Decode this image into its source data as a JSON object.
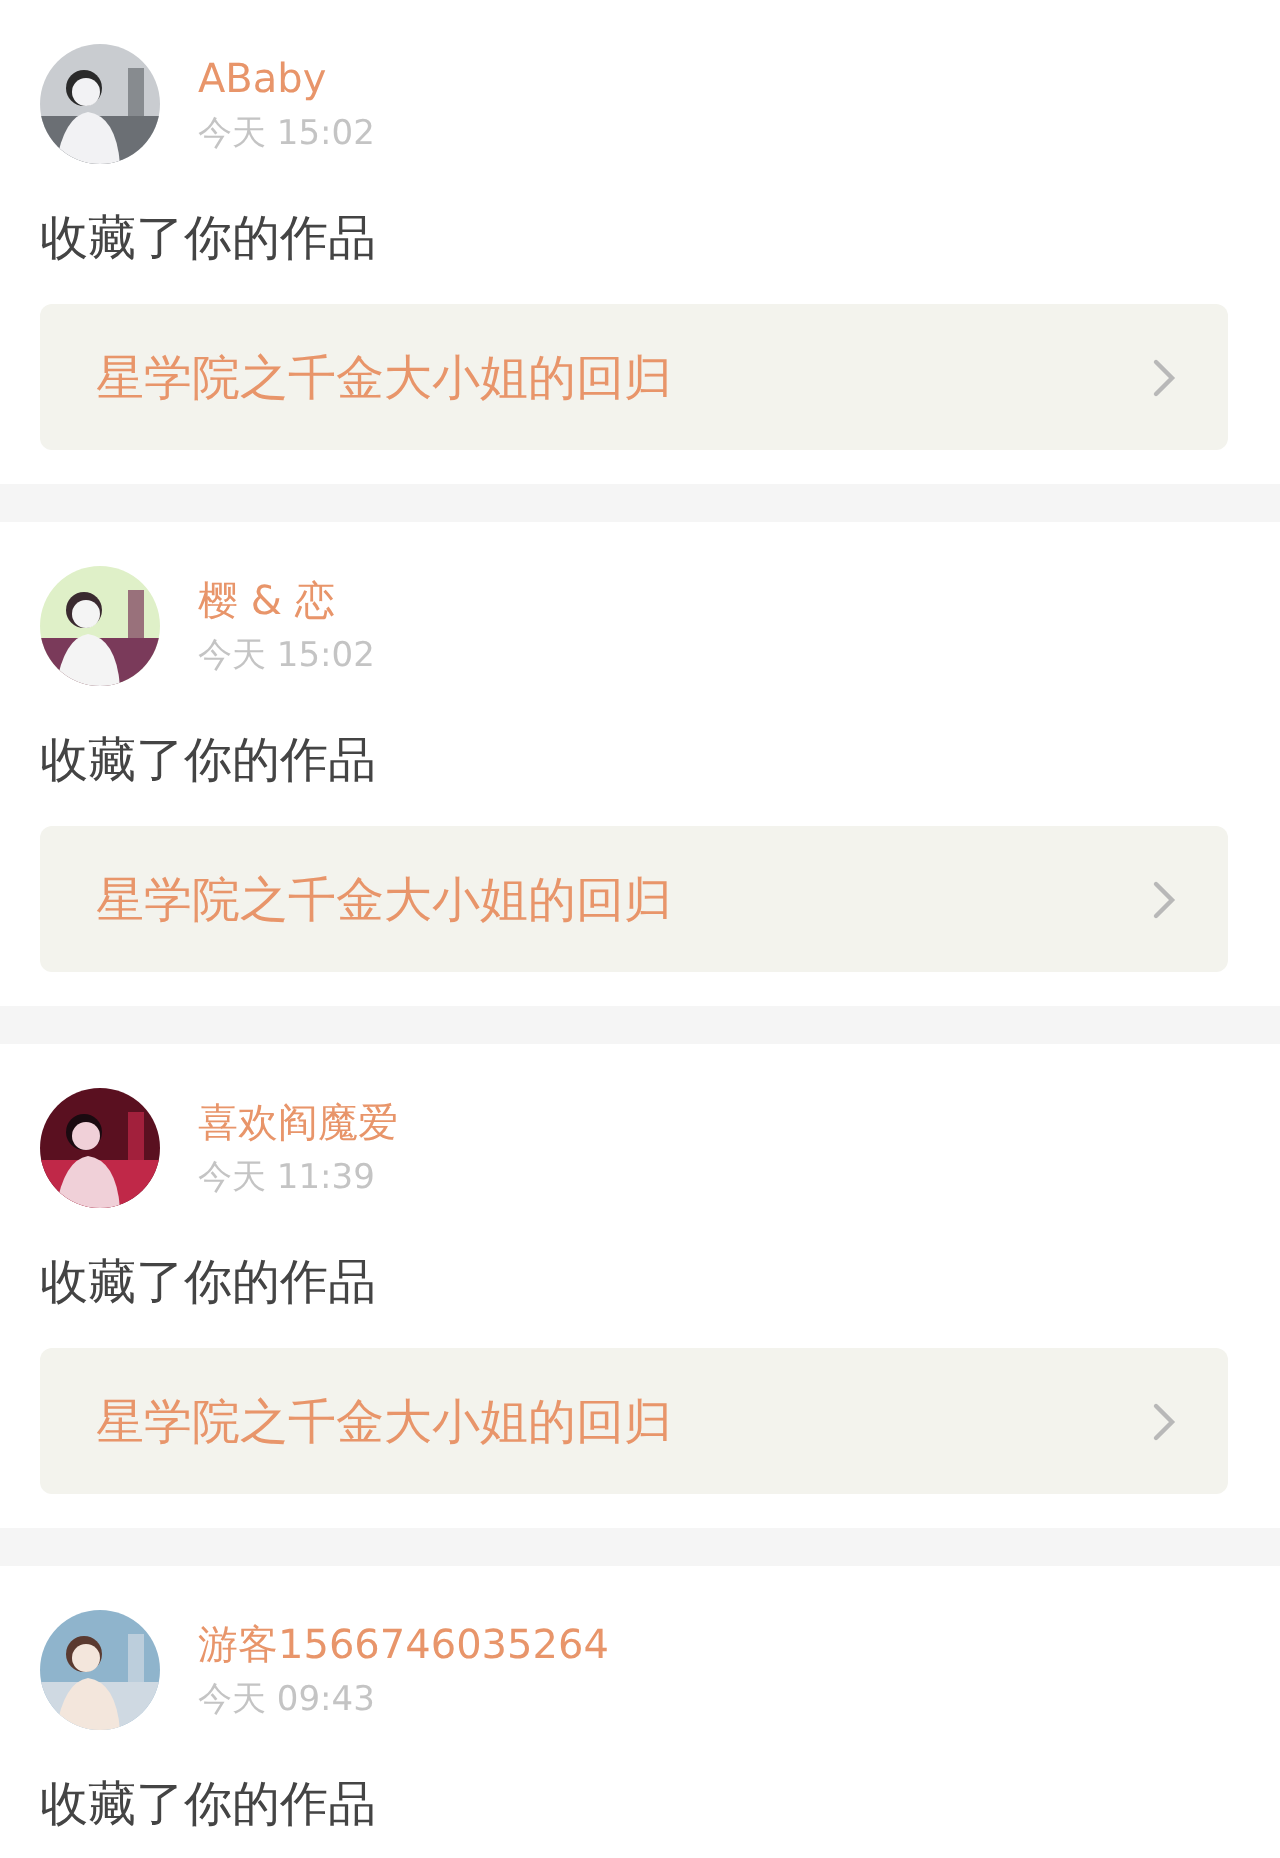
{
  "notifications": [
    {
      "name": "ABaby",
      "time": "今天 15:02",
      "action": "收藏了你的作品",
      "work": "星学院之千金大小姐的回归"
    },
    {
      "name": "樱 & 恋",
      "time": "今天 15:02",
      "action": "收藏了你的作品",
      "work": "星学院之千金大小姐的回归"
    },
    {
      "name": "喜欢阎魔爱",
      "time": "今天 11:39",
      "action": "收藏了你的作品",
      "work": "星学院之千金大小姐的回归"
    },
    {
      "name": "游客1566746035264",
      "time": "今天 09:43",
      "action": "收藏了你的作品"
    }
  ]
}
